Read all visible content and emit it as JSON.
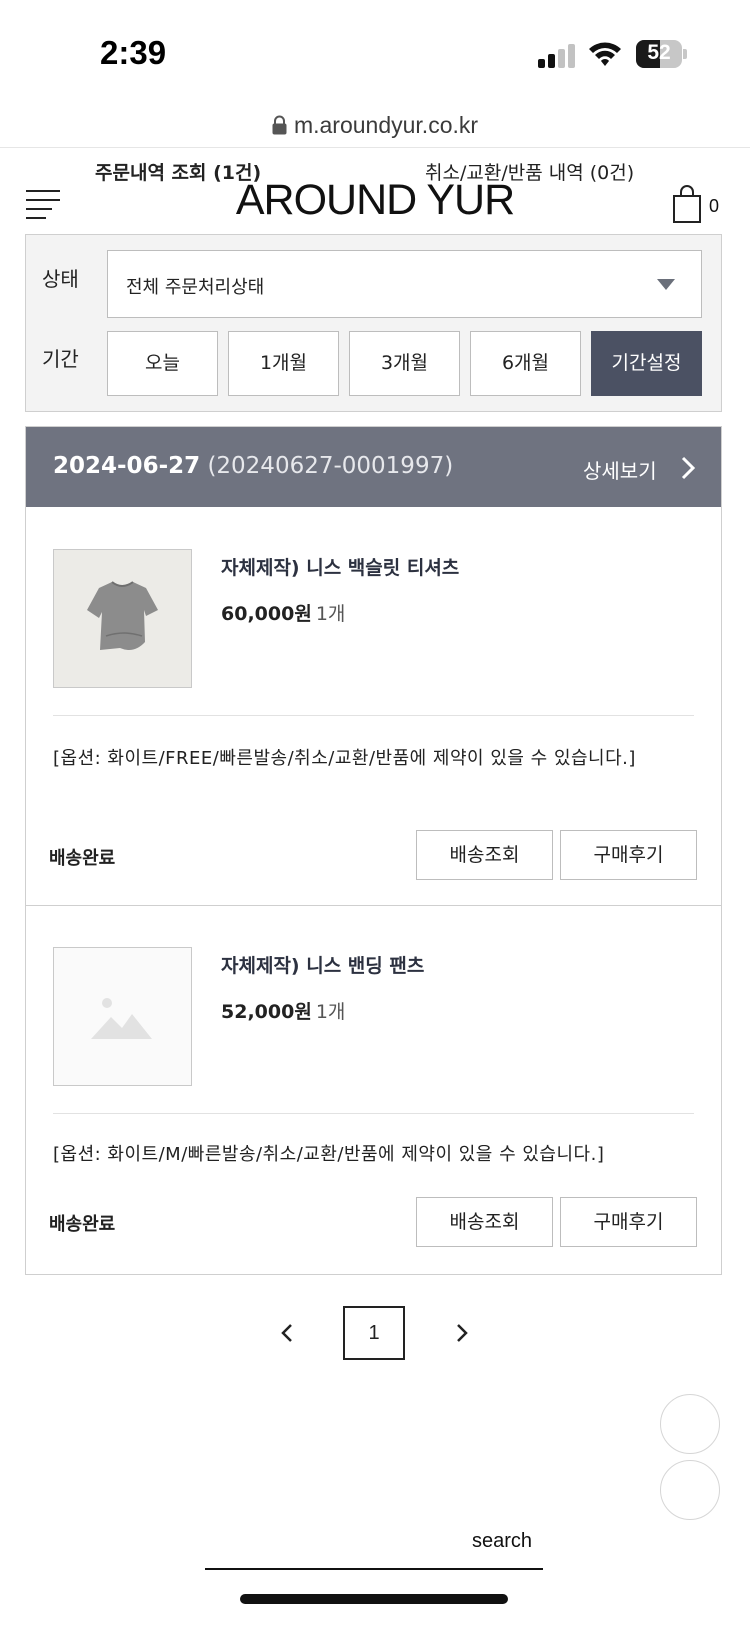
{
  "status_bar": {
    "time": "2:39",
    "battery_percent": "52",
    "battery_level": 0.52
  },
  "url_bar": {
    "url": "m.aroundyur.co.kr"
  },
  "header": {
    "logo": "AROUND YUR",
    "order_lookup": "주문내역 조회 (1건)",
    "cancel_history": "취소/교환/반품 내역 (0건)",
    "cart_count": "0"
  },
  "filter": {
    "status_label": "상태",
    "status_value": "전체 주문처리상태",
    "period_label": "기간",
    "periods": [
      "오늘",
      "1개월",
      "3개월",
      "6개월",
      "기간설정"
    ],
    "active_period": "기간설정"
  },
  "order": {
    "date": "2024-06-27",
    "order_number": "(20240627-0001997)",
    "detail_label": "상세보기",
    "items": [
      {
        "name": "자체제작) 니스 백슬릿 티셔츠",
        "price": "60,000원",
        "qty": "1개",
        "option": "[옵션: 화이트/FREE/빠른발송/취소/교환/반품에 제약이 있을 수 있습니다.]",
        "status": "배송완료",
        "track_button": "배송조회",
        "review_button": "구매후기"
      },
      {
        "name": "자체제작) 니스 밴딩 팬츠",
        "price": "52,000원",
        "qty": "1개",
        "option": "[옵션: 화이트/M/빠른발송/취소/교환/반품에 제약이 있을 수 있습니다.]",
        "status": "배송완료",
        "track_button": "배송조회",
        "review_button": "구매후기"
      }
    ]
  },
  "pagination": {
    "current_page": "1"
  },
  "footer": {
    "search_label": "search"
  },
  "colors": {
    "order_header_bg": "#6f7380",
    "active_period_bg": "#4b5163",
    "filter_bg": "#f3f3f3"
  }
}
